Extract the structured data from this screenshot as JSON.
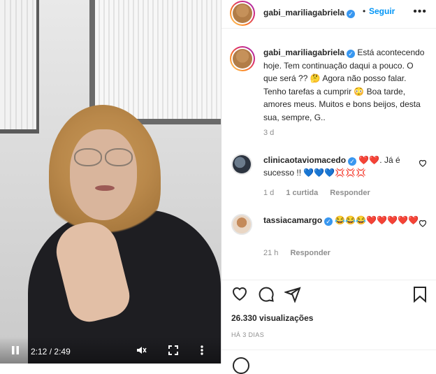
{
  "video": {
    "time_current": "2:12",
    "time_separator": "/",
    "time_total": "2:49",
    "pause_icon": "pause-icon",
    "mute_icon": "volume-muted-icon",
    "fullscreen_icon": "fullscreen-icon",
    "more_icon": "vertical-dots-icon"
  },
  "header": {
    "username": "gabi_mariliagabriela",
    "follow_label": "Seguir",
    "more_label": "•••"
  },
  "caption": {
    "username": "gabi_mariliagabriela",
    "text": "Está acontecendo hoje. Tem continuação daqui a pouco. O que será ?? 🤔 Agora não posso falar. Tenho tarefas a cumprir 😳 Boa tarde, amores meus. Muitos e bons beijos, desta sua, sempre, G..",
    "age": "3 d"
  },
  "comments": [
    {
      "username": "clinicaotaviomacedo",
      "text": "❤️❤️. Já é sucesso !! 💙💙💙💢💢💢",
      "age": "1 d",
      "likes": "1 curtida",
      "reply_label": "Responder"
    },
    {
      "username": "tassiacamargo",
      "text": "😂😂😂❤️❤️❤️❤️❤️",
      "age": "21 h",
      "reply_label": "Responder"
    }
  ],
  "actions": {
    "like_icon": "heart-icon",
    "comment_icon": "comment-icon",
    "share_icon": "paper-plane-icon",
    "save_icon": "bookmark-icon"
  },
  "stats": {
    "views": "26.330 visualizações",
    "date": "HÁ 3 DIAS"
  },
  "colors": {
    "accent": "#0095f6",
    "verified": "#3897f0",
    "secondary_text": "#8e8e8e",
    "heart_red": "#ed4956"
  }
}
